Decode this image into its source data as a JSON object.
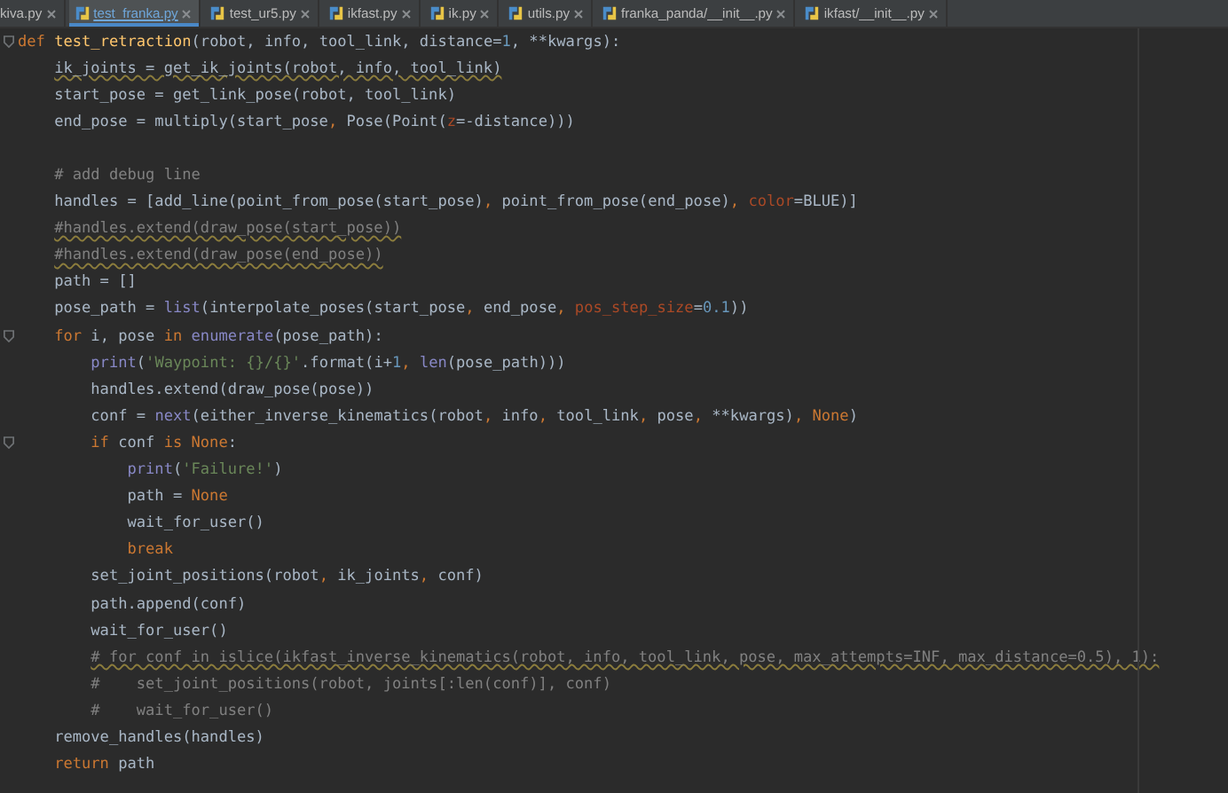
{
  "tabs": [
    {
      "label": "kiva.py",
      "selected": false,
      "icon": false
    },
    {
      "label": "test_franka.py",
      "selected": true,
      "icon": true
    },
    {
      "label": "test_ur5.py",
      "selected": false,
      "icon": true
    },
    {
      "label": "ikfast.py",
      "selected": false,
      "icon": true
    },
    {
      "label": "ik.py",
      "selected": false,
      "icon": true
    },
    {
      "label": "utils.py",
      "selected": false,
      "icon": true
    },
    {
      "label": "franka_panda/__init__.py",
      "selected": false,
      "icon": true
    },
    {
      "label": "ikfast/__init__.py",
      "selected": false,
      "icon": true
    }
  ],
  "code": [
    {
      "kind": "code",
      "warning": false,
      "tokens": [
        {
          "kind": "keyword",
          "text": "def "
        },
        {
          "kind": "function",
          "text": "test_retraction"
        },
        {
          "kind": "plain",
          "text": "(robot, info, tool_link, distance="
        },
        {
          "kind": "number",
          "text": "1"
        },
        {
          "kind": "plain",
          "text": ", **kwargs):"
        }
      ],
      "children": [
        {
          "kind": "code",
          "warning": true,
          "tokens": [
            {
              "kind": "plain",
              "text": "ik_joints = get_ik_joints(robot, info, tool_link)"
            }
          ]
        },
        {
          "kind": "code",
          "warning": false,
          "tokens": [
            {
              "kind": "plain",
              "text": "start_pose = get_link_pose(robot, tool_link)"
            }
          ]
        },
        {
          "kind": "code",
          "warning": false,
          "tokens": [
            {
              "kind": "plain",
              "text": "end_pose = multiply(start_pose"
            },
            {
              "kind": "keyword",
              "text": ", "
            },
            {
              "kind": "plain",
              "text": "Pose(Point("
            },
            {
              "kind": "param",
              "text": "z"
            },
            {
              "kind": "plain",
              "text": "=-distance)))"
            }
          ]
        },
        {
          "kind": "blank"
        },
        {
          "kind": "code",
          "warning": false,
          "tokens": [
            {
              "kind": "comment",
              "text": "# add debug line"
            }
          ]
        },
        {
          "kind": "code",
          "warning": false,
          "tokens": [
            {
              "kind": "plain",
              "text": "handles = [add_line(point_from_pose(start_pose)"
            },
            {
              "kind": "keyword",
              "text": ", "
            },
            {
              "kind": "plain",
              "text": "point_from_pose(end_pose)"
            },
            {
              "kind": "keyword",
              "text": ", "
            },
            {
              "kind": "param",
              "text": "color"
            },
            {
              "kind": "plain",
              "text": "=BLUE)]"
            }
          ]
        },
        {
          "kind": "code",
          "warning": true,
          "tokens": [
            {
              "kind": "comment",
              "text": "#handles.extend(draw_pose(start_pose))"
            }
          ]
        },
        {
          "kind": "code",
          "warning": true,
          "tokens": [
            {
              "kind": "comment",
              "text": "#handles.extend(draw_pose(end_pose))"
            }
          ]
        },
        {
          "kind": "code",
          "warning": false,
          "tokens": [
            {
              "kind": "plain",
              "text": "path = []"
            }
          ]
        },
        {
          "kind": "code",
          "warning": false,
          "tokens": [
            {
              "kind": "plain",
              "text": "pose_path = "
            },
            {
              "kind": "builtin",
              "text": "list"
            },
            {
              "kind": "plain",
              "text": "(interpolate_poses(start_pose"
            },
            {
              "kind": "keyword",
              "text": ", "
            },
            {
              "kind": "plain",
              "text": "end_pose"
            },
            {
              "kind": "keyword",
              "text": ", "
            },
            {
              "kind": "param",
              "text": "pos_step_size"
            },
            {
              "kind": "plain",
              "text": "="
            },
            {
              "kind": "number",
              "text": "0.1"
            },
            {
              "kind": "plain",
              "text": "))"
            }
          ]
        },
        {
          "kind": "code",
          "warning": false,
          "tokens": [
            {
              "kind": "keyword",
              "text": "for "
            },
            {
              "kind": "plain",
              "text": "i, pose "
            },
            {
              "kind": "keyword",
              "text": "in "
            },
            {
              "kind": "builtin",
              "text": "enumerate"
            },
            {
              "kind": "plain",
              "text": "(pose_path):"
            }
          ],
          "children": [
            {
              "kind": "code",
              "warning": false,
              "tokens": [
                {
                  "kind": "builtin",
                  "text": "print"
                },
                {
                  "kind": "plain",
                  "text": "("
                },
                {
                  "kind": "string",
                  "text": "'Waypoint: {}/{}'"
                },
                {
                  "kind": "plain",
                  "text": ".format(i+"
                },
                {
                  "kind": "number",
                  "text": "1"
                },
                {
                  "kind": "keyword",
                  "text": ", "
                },
                {
                  "kind": "builtin",
                  "text": "len"
                },
                {
                  "kind": "plain",
                  "text": "(pose_path)))"
                }
              ]
            },
            {
              "kind": "code",
              "warning": false,
              "tokens": [
                {
                  "kind": "plain",
                  "text": "handles.extend(draw_pose(pose))"
                }
              ]
            },
            {
              "kind": "code",
              "warning": false,
              "tokens": [
                {
                  "kind": "plain",
                  "text": "conf = "
                },
                {
                  "kind": "builtin",
                  "text": "next"
                },
                {
                  "kind": "plain",
                  "text": "(either_inverse_kinematics(robot"
                },
                {
                  "kind": "keyword",
                  "text": ", "
                },
                {
                  "kind": "plain",
                  "text": "info"
                },
                {
                  "kind": "keyword",
                  "text": ", "
                },
                {
                  "kind": "plain",
                  "text": "tool_link"
                },
                {
                  "kind": "keyword",
                  "text": ", "
                },
                {
                  "kind": "plain",
                  "text": "pose"
                },
                {
                  "kind": "keyword",
                  "text": ", "
                },
                {
                  "kind": "plain",
                  "text": "**kwargs)"
                },
                {
                  "kind": "keyword",
                  "text": ", None"
                },
                {
                  "kind": "plain",
                  "text": ")"
                }
              ]
            },
            {
              "kind": "code",
              "warning": false,
              "tokens": [
                {
                  "kind": "keyword",
                  "text": "if "
                },
                {
                  "kind": "plain",
                  "text": "conf "
                },
                {
                  "kind": "keyword",
                  "text": "is None"
                },
                {
                  "kind": "plain",
                  "text": ":"
                }
              ],
              "children": [
                {
                  "kind": "code",
                  "warning": false,
                  "tokens": [
                    {
                      "kind": "builtin",
                      "text": "print"
                    },
                    {
                      "kind": "plain",
                      "text": "("
                    },
                    {
                      "kind": "string",
                      "text": "'Failure!'"
                    },
                    {
                      "kind": "plain",
                      "text": ")"
                    }
                  ]
                },
                {
                  "kind": "code",
                  "warning": false,
                  "tokens": [
                    {
                      "kind": "plain",
                      "text": "path = "
                    },
                    {
                      "kind": "keyword",
                      "text": "None"
                    }
                  ]
                },
                {
                  "kind": "code",
                  "warning": false,
                  "tokens": [
                    {
                      "kind": "plain",
                      "text": "wait_for_user()"
                    }
                  ]
                },
                {
                  "kind": "code",
                  "warning": false,
                  "tokens": [
                    {
                      "kind": "keyword",
                      "text": "break"
                    }
                  ]
                }
              ]
            },
            {
              "kind": "code",
              "warning": false,
              "tokens": [
                {
                  "kind": "plain",
                  "text": "set_joint_positions(robot"
                },
                {
                  "kind": "keyword",
                  "text": ", "
                },
                {
                  "kind": "plain",
                  "text": "ik_joints"
                },
                {
                  "kind": "keyword",
                  "text": ", "
                },
                {
                  "kind": "plain",
                  "text": "conf)"
                }
              ]
            },
            {
              "kind": "code",
              "warning": false,
              "tokens": [
                {
                  "kind": "plain",
                  "text": "path.append(conf)"
                }
              ]
            },
            {
              "kind": "code",
              "warning": false,
              "tokens": [
                {
                  "kind": "plain",
                  "text": "wait_for_user()"
                }
              ]
            },
            {
              "kind": "code",
              "warning": true,
              "tokens": [
                {
                  "kind": "comment",
                  "text": "# for conf in islice(ikfast_inverse_kinematics(robot, info, tool_link, pose, max_attempts=INF, max_distance=0.5), 1):"
                }
              ]
            },
            {
              "kind": "code",
              "warning": false,
              "tokens": [
                {
                  "kind": "comment",
                  "text": "#    set_joint_positions(robot, joints[:len(conf)], conf)"
                }
              ]
            },
            {
              "kind": "code",
              "warning": false,
              "tokens": [
                {
                  "kind": "comment",
                  "text": "#    wait_for_user()"
                }
              ]
            }
          ]
        },
        {
          "kind": "code",
          "warning": false,
          "tokens": [
            {
              "kind": "plain",
              "text": "remove_handles(handles)"
            }
          ]
        },
        {
          "kind": "code",
          "warning": false,
          "tokens": [
            {
              "kind": "keyword",
              "text": "return "
            },
            {
              "kind": "plain",
              "text": "path"
            }
          ]
        }
      ]
    }
  ]
}
